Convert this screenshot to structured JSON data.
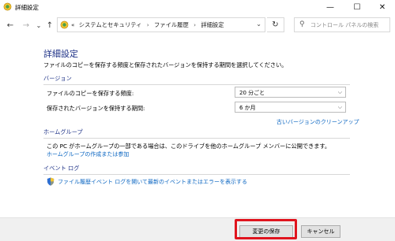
{
  "window": {
    "title": "詳細設定",
    "minimize_glyph": "—",
    "maximize_glyph": "☐",
    "close_glyph": "✕"
  },
  "nav": {
    "back_glyph": "←",
    "forward_glyph": "→",
    "recent_glyph": "⌄",
    "up_glyph": "↑",
    "breadcrumb_overflow": "«",
    "breadcrumbs": [
      "システムとセキュリティ",
      "ファイル履歴",
      "詳細設定"
    ],
    "dropdown_glyph": "⌄",
    "refresh_glyph": "↻",
    "search_placeholder": "コントロール パネルの検索"
  },
  "main": {
    "title": "詳細設定",
    "description": "ファイルのコピーを保存する頻度と保存されたバージョンを保持する期間を選択してください。",
    "versions": {
      "header": "バージョン",
      "frequency_label": "ファイルのコピーを保存する頻度:",
      "frequency_value": "20 分ごと",
      "retention_label": "保存されたバージョンを保持する期間:",
      "retention_value": "6 か月",
      "cleanup_link": "古いバージョンのクリーンアップ"
    },
    "homegroup": {
      "header": "ホームグループ",
      "text": "この PC がホームグループの一部である場合は、このドライブを他のホームグループ メンバーに公開できます。",
      "link": "ホームグループの作成または参加"
    },
    "eventlog": {
      "header": "イベント ログ",
      "link": "ファイル履歴イベント ログを開いて最新のイベントまたはエラーを表示する"
    }
  },
  "footer": {
    "save_label": "変更の保存",
    "cancel_label": "キャンセル"
  },
  "colors": {
    "heading_blue": "#1e3287",
    "link_blue": "#0b66c2",
    "highlight_red": "#e0141e"
  }
}
